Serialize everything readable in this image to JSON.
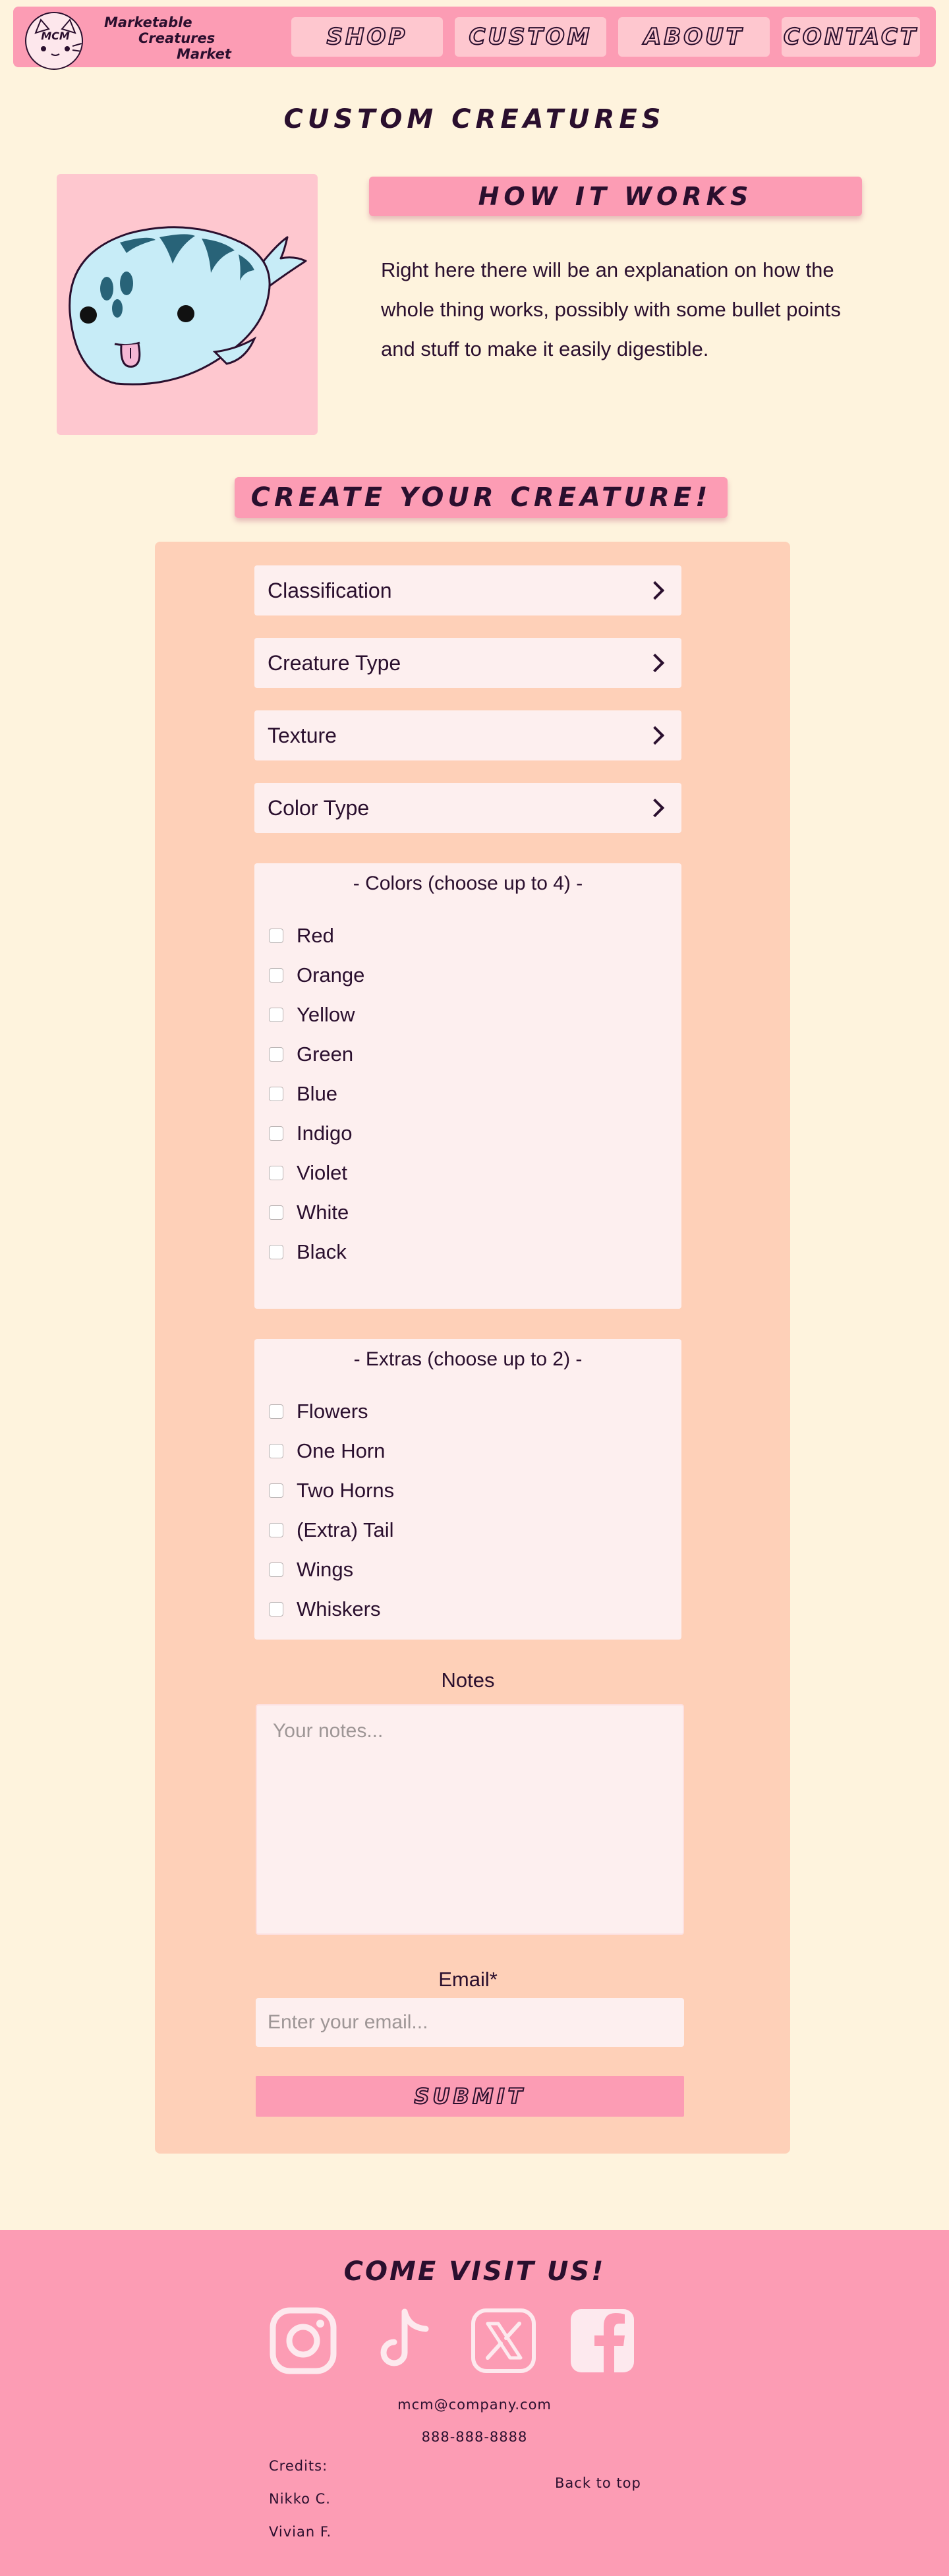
{
  "brand": {
    "logo_badge": "MCM",
    "name_line1": "Marketable",
    "name_line2": "Creatures",
    "name_line3": "Market"
  },
  "nav": {
    "items": [
      {
        "label": "SHOP"
      },
      {
        "label": "CUSTOM"
      },
      {
        "label": "ABOUT"
      },
      {
        "label": "CONTACT"
      }
    ]
  },
  "page": {
    "title": "CUSTOM CREATURES"
  },
  "how_it_works": {
    "heading": "HOW IT WORKS",
    "body": "Right here there will be an explanation on how the whole thing works, possibly with some bullet points and stuff to make it easily digestible."
  },
  "create": {
    "heading": "CREATE YOUR CREATURE!",
    "selects": [
      {
        "label": "Classification"
      },
      {
        "label": "Creature Type"
      },
      {
        "label": "Texture"
      },
      {
        "label": "Color Type"
      }
    ],
    "colors": {
      "title": "- Colors (choose up to 4) -",
      "options": [
        "Red",
        "Orange",
        "Yellow",
        "Green",
        "Blue",
        "Indigo",
        "Violet",
        "White",
        "Black"
      ]
    },
    "extras": {
      "title": "- Extras (choose up to 2) -",
      "options": [
        "Flowers",
        "One Horn",
        "Two Horns",
        "(Extra) Tail",
        "Wings",
        "Whiskers"
      ]
    },
    "notes_label": "Notes",
    "notes_placeholder": "Your notes...",
    "email_label": "Email*",
    "email_placeholder": "Enter your email...",
    "submit_label": "SUBMIT"
  },
  "footer": {
    "title": "COME VISIT US!",
    "socials": [
      "instagram-icon",
      "tiktok-icon",
      "x-icon",
      "facebook-icon"
    ],
    "email": "mcm@company.com",
    "phone": "888-888-8888",
    "credits_label": "Credits:",
    "credits": [
      "Nikko C.",
      "Vivian F."
    ],
    "back_to_top": "Back to top"
  },
  "colors": {
    "page_bg": "#fef3dd",
    "accent_pink": "#fc9cb4",
    "light_pink": "#fec7cf",
    "peach": "#fed0b8",
    "ink": "#2a0f2e",
    "creature_blue": "#c7ecf7",
    "creature_stripe": "#286378"
  }
}
